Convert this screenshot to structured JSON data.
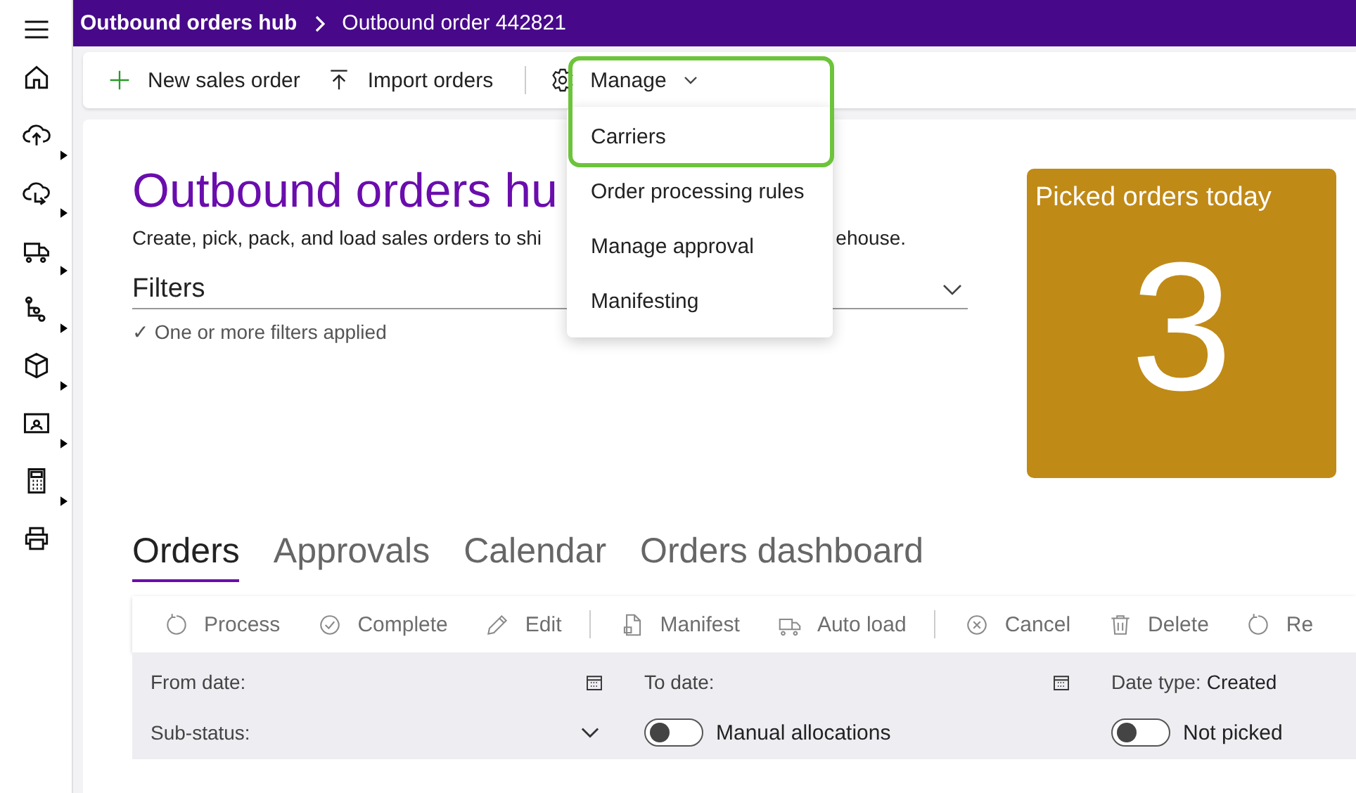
{
  "breadcrumb": [
    {
      "label": "Outbound orders hub",
      "current": false
    },
    {
      "label": "Outbound order 442821",
      "current": true
    }
  ],
  "sidebar": {
    "items": [
      {
        "submenu": false
      },
      {
        "submenu": true
      },
      {
        "submenu": true
      },
      {
        "submenu": true
      },
      {
        "submenu": true
      },
      {
        "submenu": true
      },
      {
        "submenu": true
      },
      {
        "submenu": true
      },
      {
        "submenu": false
      }
    ]
  },
  "action_bar": {
    "buttons": [
      {
        "label": "New sales order"
      },
      {
        "label": "Import orders"
      },
      {
        "label": "Manage"
      }
    ]
  },
  "manage_menu": {
    "items": [
      {
        "label": "Carriers"
      },
      {
        "label": "Order processing rules"
      },
      {
        "label": "Manage approval"
      },
      {
        "label": "Manifesting"
      }
    ]
  },
  "header": {
    "title": "Outbound orders hu",
    "description": [
      "Create, pick, pack, and load sales orders to shi",
      "ehouse."
    ]
  },
  "filters": {
    "label": "Filters",
    "status": "✓ One or more filters applied"
  },
  "tile": {
    "title": "Picked orders today",
    "value": "3"
  },
  "tabs": [
    {
      "label": "Orders",
      "selected": true
    },
    {
      "label": "Approvals",
      "selected": false
    },
    {
      "label": "Calendar",
      "selected": false
    },
    {
      "label": "Orders dashboard",
      "selected": false
    }
  ],
  "grid_toolbar": {
    "buttons": [
      {
        "kind": "button",
        "label": "Process",
        "disabled": true
      },
      {
        "kind": "button",
        "label": "Complete",
        "disabled": true
      },
      {
        "kind": "button",
        "label": "Edit",
        "disabled": true
      },
      {
        "kind": "separator"
      },
      {
        "kind": "button",
        "label": "Manifest",
        "disabled": true
      },
      {
        "kind": "button",
        "label": "Auto load",
        "disabled": true
      },
      {
        "kind": "separator"
      },
      {
        "kind": "button",
        "label": "Cancel",
        "disabled": true
      },
      {
        "kind": "button",
        "label": "Delete",
        "disabled": true
      },
      {
        "kind": "button",
        "label": "Re",
        "disabled": true
      }
    ]
  },
  "grid_filters": {
    "from_date": "From date:",
    "to_date": "To date:",
    "date_type": {
      "label": "Date type:",
      "value": "Created"
    },
    "sub_status": "Sub-status:",
    "toggles": [
      {
        "label": "Manual allocations",
        "on": false
      },
      {
        "label": "Not picked",
        "on": false
      }
    ]
  }
}
